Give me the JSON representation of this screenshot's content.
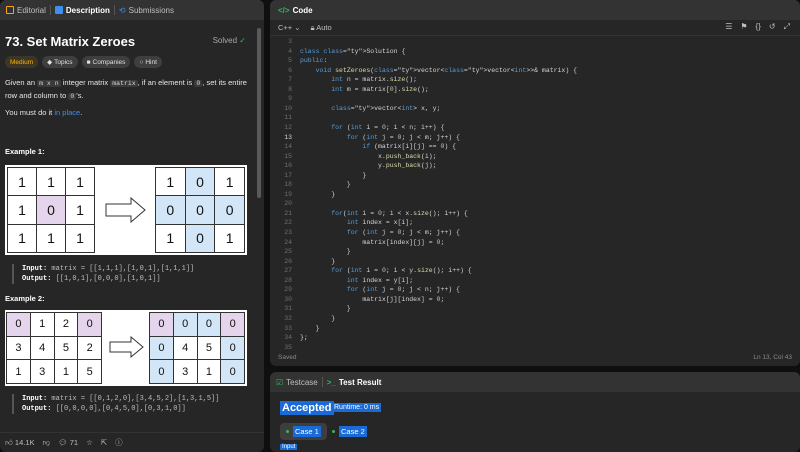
{
  "left_tabs": {
    "editorial": "Editorial",
    "description": "Description",
    "submissions": "Submissions"
  },
  "problem": {
    "title": "73. Set Matrix Zeroes",
    "status": "Solved",
    "tags": [
      "Medium",
      "Topics",
      "Companies",
      "Hint"
    ],
    "desc_1": "Given an",
    "desc_code_1": "m x n",
    "desc_2": "integer matrix",
    "desc_code_2": "matrix",
    "desc_3": ", if an element is",
    "desc_code_3": "0",
    "desc_4": ", set its entire row and column to",
    "desc_code_4": "0",
    "desc_5": "'s.",
    "must_1": "You must do it",
    "must_link": "in place",
    "must_2": "."
  },
  "example1": {
    "heading": "Example 1:",
    "input_grid": [
      [
        "1",
        "1",
        "1"
      ],
      [
        "1",
        "0",
        "1"
      ],
      [
        "1",
        "1",
        "1"
      ]
    ],
    "output_grid": [
      [
        "1",
        "0",
        "1"
      ],
      [
        "0",
        "0",
        "0"
      ],
      [
        "1",
        "0",
        "1"
      ]
    ],
    "input_label": "Input:",
    "input_value": "matrix = [[1,1,1],[1,0,1],[1,1,1]]",
    "output_label": "Output:",
    "output_value": "[[1,0,1],[0,0,0],[1,0,1]]"
  },
  "example2": {
    "heading": "Example 2:",
    "input_grid": [
      [
        "0",
        "1",
        "2",
        "0"
      ],
      [
        "3",
        "4",
        "5",
        "2"
      ],
      [
        "1",
        "3",
        "1",
        "5"
      ]
    ],
    "output_grid": [
      [
        "0",
        "0",
        "0",
        "0"
      ],
      [
        "0",
        "4",
        "5",
        "0"
      ],
      [
        "0",
        "3",
        "1",
        "0"
      ]
    ],
    "input_label": "Input:",
    "input_value": "matrix = [[0,1,2,0],[3,4,5,2],[1,3,1,5]]",
    "output_label": "Output:",
    "output_value": "[[0,0,0,0],[0,4,5,0],[0,3,1,0]]"
  },
  "footer": {
    "likes": "14.1K",
    "comments": "71"
  },
  "editor": {
    "tab": "Code",
    "language": "C++",
    "mode": "Auto",
    "saved": "Saved",
    "cursor": "Ln 13, Col 43",
    "lines": [
      {
        "n": "3",
        "t": ""
      },
      {
        "n": "4",
        "t": "class Solution {"
      },
      {
        "n": "5",
        "t": "public:"
      },
      {
        "n": "6",
        "t": "    void setZeroes(vector<vector<int>>& matrix) {"
      },
      {
        "n": "7",
        "t": "        int n = matrix.size();"
      },
      {
        "n": "8",
        "t": "        int m = matrix[0].size();"
      },
      {
        "n": "9",
        "t": ""
      },
      {
        "n": "10",
        "t": "        vector<int> x, y;"
      },
      {
        "n": "11",
        "t": ""
      },
      {
        "n": "12",
        "t": "        for (int i = 0; i < n; i++) {"
      },
      {
        "n": "13",
        "t": "            for (int j = 0; j < m; j++) {"
      },
      {
        "n": "14",
        "t": "                if (matrix[i][j] == 0) {"
      },
      {
        "n": "15",
        "t": "                    x.push_back(i);"
      },
      {
        "n": "16",
        "t": "                    y.push_back(j);"
      },
      {
        "n": "17",
        "t": "                }"
      },
      {
        "n": "18",
        "t": "            }"
      },
      {
        "n": "19",
        "t": "        }"
      },
      {
        "n": "20",
        "t": ""
      },
      {
        "n": "21",
        "t": "        for(int i = 0; i < x.size(); i++) {"
      },
      {
        "n": "22",
        "t": "            int index = x[i];"
      },
      {
        "n": "23",
        "t": "            for (int j = 0; j < m; j++) {"
      },
      {
        "n": "24",
        "t": "                matrix[index][j] = 0;"
      },
      {
        "n": "25",
        "t": "            }"
      },
      {
        "n": "26",
        "t": "        }"
      },
      {
        "n": "27",
        "t": "        for (int i = 0; i < y.size(); i++) {"
      },
      {
        "n": "28",
        "t": "            int index = y[i];"
      },
      {
        "n": "29",
        "t": "            for (int j = 0; j < n; j++) {"
      },
      {
        "n": "30",
        "t": "                matrix[j][index] = 0;"
      },
      {
        "n": "31",
        "t": "            }"
      },
      {
        "n": "32",
        "t": "        }"
      },
      {
        "n": "33",
        "t": "    }"
      },
      {
        "n": "34",
        "t": "};"
      },
      {
        "n": "35",
        "t": ""
      }
    ]
  },
  "tests": {
    "tab_testcase": "Testcase",
    "tab_result": "Test Result",
    "status": "Accepted",
    "runtime": "Runtime: 0 ms",
    "case1": "Case 1",
    "case2": "Case 2",
    "input_label": "Input"
  },
  "colors": {
    "accent": "#1a6bd6",
    "success": "#2cbb5d",
    "medium": "#ffb800",
    "zero_cell": "#e4d4ec",
    "zeroed_cell": "#d2e6f7"
  }
}
